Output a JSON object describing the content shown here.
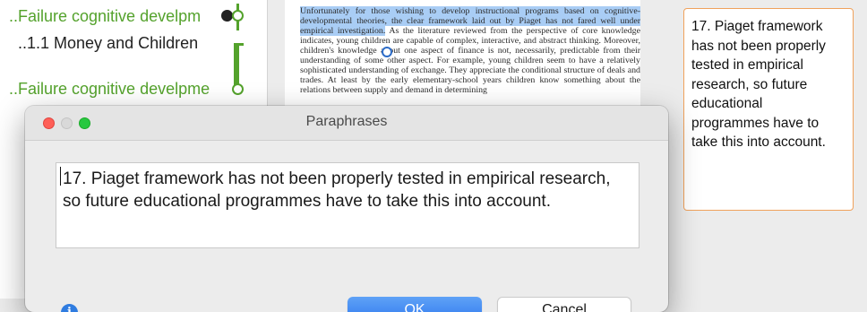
{
  "code_tree": {
    "items": [
      {
        "label": "..Failure cognitive develpm",
        "color": "#54a22c"
      },
      {
        "label": "..1.1 Money and Children",
        "color": "#222222"
      },
      {
        "label": "..Failure cognitive develpme",
        "color": "#54a22c"
      }
    ]
  },
  "document": {
    "highlighted_text": "Unfortunately for those wishing to develop instructional programs based on cognitive-developmental theories, the clear framework laid out by Piaget has not fared well under empirical investigation.",
    "body_text": " As the literature reviewed from the perspective of core knowledge indicates, young children are capable of complex, interactive, and abstract thinking. Moreover, children's knowledge about one aspect of finance is not, necessarily, predictable from their understanding of some other aspect. For example, young children seem to have a relatively sophisticated understanding of exchange. They appreciate the conditional structure of deals and trades. At least by the early elementary-school years children know something about the relations between supply and demand in determining",
    "highlight_color": "#a9cdf5"
  },
  "memo_card": {
    "text": "17. Piaget framework has not been properly tested in empirical research, so future educational programmes have to take this into account.",
    "border_color": "#f0a25c"
  },
  "dialog": {
    "title": "Paraphrases",
    "input_value": "17. Piaget framework has not been properly tested in empirical research, so future educational programmes have to take this into account.",
    "ok_label": "OK",
    "cancel_label": "Cancel",
    "info_glyph": "i",
    "accent_color": "#2f78ef"
  }
}
